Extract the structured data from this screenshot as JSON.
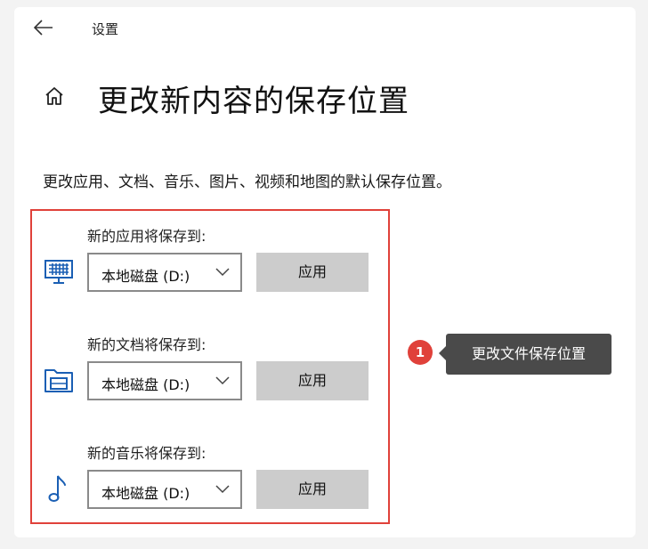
{
  "header": {
    "app_title": "设置"
  },
  "page": {
    "title": "更改新内容的保存位置",
    "description": "更改应用、文档、音乐、图片、视频和地图的默认保存位置。"
  },
  "settings": [
    {
      "label": "新的应用将保存到:",
      "icon": "monitor-icon",
      "drive": "本地磁盘 (D:)",
      "apply_label": "应用"
    },
    {
      "label": "新的文档将保存到:",
      "icon": "folder-drive-icon",
      "drive": "本地磁盘 (D:)",
      "apply_label": "应用"
    },
    {
      "label": "新的音乐将保存到:",
      "icon": "music-note-icon",
      "drive": "本地磁盘 (D:)",
      "apply_label": "应用"
    }
  ],
  "callout": {
    "number": "1",
    "text": "更改文件保存位置"
  },
  "colors": {
    "accent_icon": "#1a5fb4",
    "highlight": "#e0413a",
    "button": "#cccccc",
    "tooltip": "#4a4a4a"
  }
}
